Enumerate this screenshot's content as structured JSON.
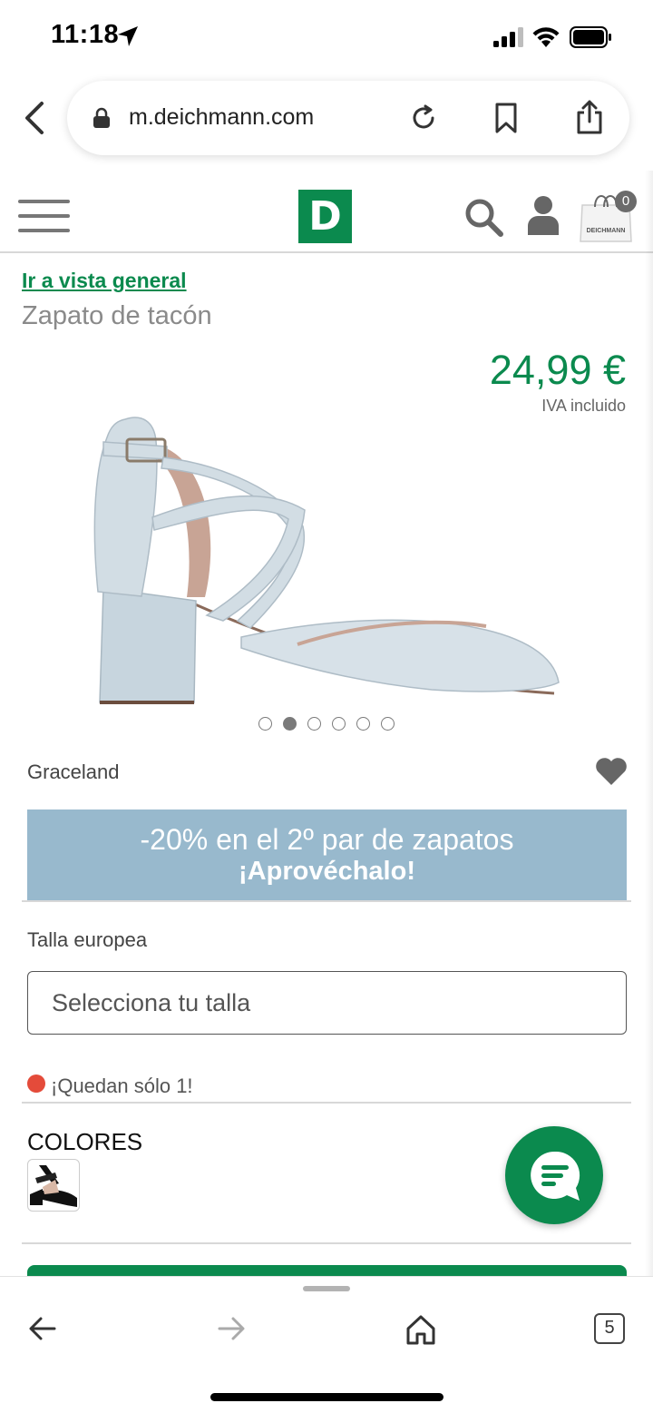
{
  "status_bar": {
    "time": "11:18"
  },
  "browser": {
    "url": "m.deichmann.com"
  },
  "header": {
    "logo_letter": "D",
    "cart_count": "0",
    "cart_brand": "DEICHMANN"
  },
  "product": {
    "overview_link": "Ir a vista general",
    "title": "Zapato de tacón",
    "price": "24,99 €",
    "vat_note": "IVA incluido",
    "brand": "Graceland",
    "image_count": 6,
    "active_image": 2
  },
  "promo": {
    "line1": "-20% en el 2º par de zapatos",
    "line2": "¡Aprovéchalo!",
    "background": "#98b9cd"
  },
  "size": {
    "label": "Talla europea",
    "placeholder": "Selecciona tu talla"
  },
  "stock": {
    "text": "¡Quedan sólo 1!",
    "color": "#e44b3a"
  },
  "colors": {
    "title": "COLORES"
  },
  "bottom_toolbar": {
    "tab_count": "5"
  },
  "theme": {
    "brand_green": "#0b8a4e"
  },
  "icons": [
    "location-arrow-icon",
    "signal-icon",
    "wifi-icon",
    "battery-icon",
    "back-chevron-icon",
    "lock-icon",
    "reload-icon",
    "bookmark-icon",
    "share-icon",
    "menu-icon",
    "search-icon",
    "user-icon",
    "shopping-bag-icon",
    "heart-icon",
    "chat-icon",
    "arrow-left-icon",
    "arrow-right-icon",
    "home-icon"
  ]
}
